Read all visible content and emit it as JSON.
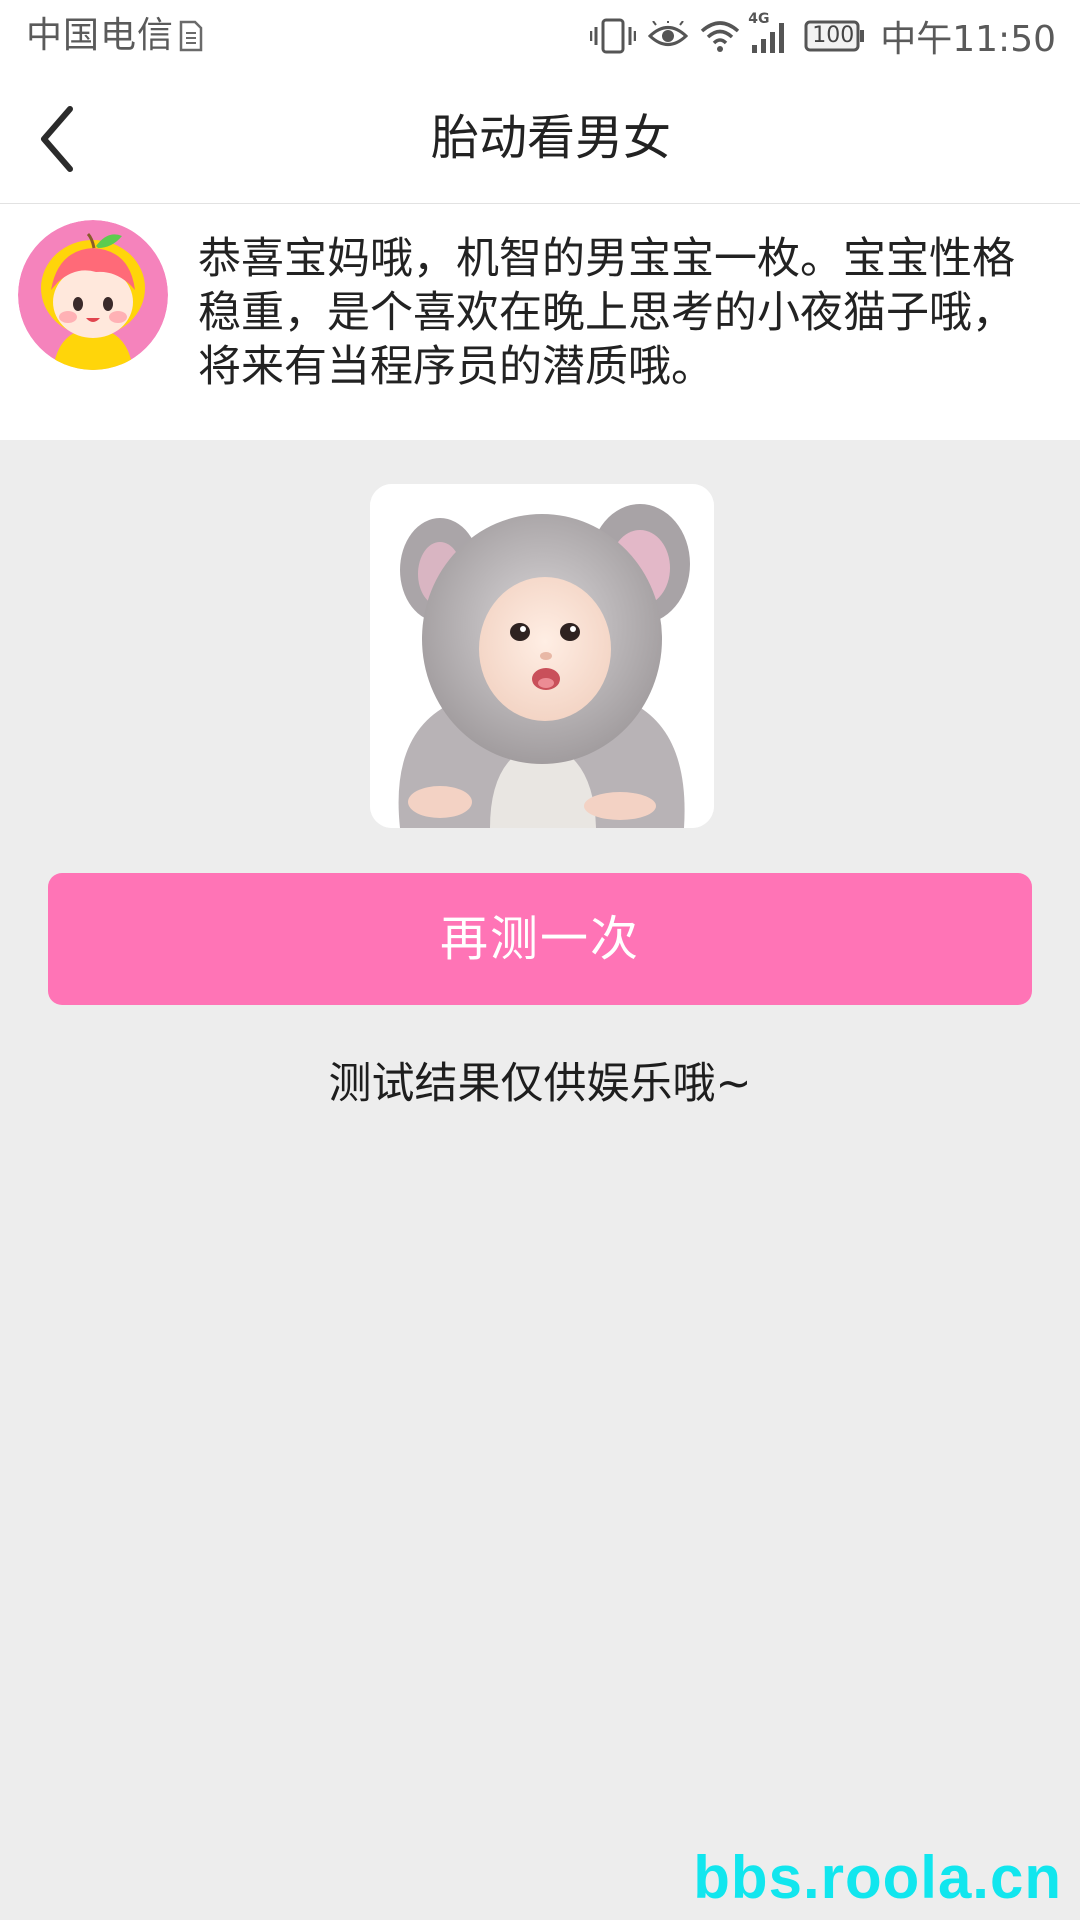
{
  "status_bar": {
    "carrier": "中国电信",
    "time": "中午11:50",
    "network": "4G",
    "battery": "100",
    "icons": [
      "vibrate-icon",
      "eye-icon",
      "wifi-icon",
      "signal-icon",
      "battery-icon",
      "sim-card-icon"
    ]
  },
  "header": {
    "title": "胎动看男女"
  },
  "result": {
    "text": "恭喜宝妈哦，机智的男宝宝一枚。宝宝性格稳重，是个喜欢在晚上思考的小夜猫子哦，将来有当程序员的潜质哦。"
  },
  "actions": {
    "retry_label": "再测一次"
  },
  "disclaimer": "测试结果仅供娱乐哦~",
  "watermark": "bbs.roola.cn",
  "colors": {
    "accent": "#ff74b6",
    "background": "#ededed",
    "watermark": "#11e6ee"
  }
}
